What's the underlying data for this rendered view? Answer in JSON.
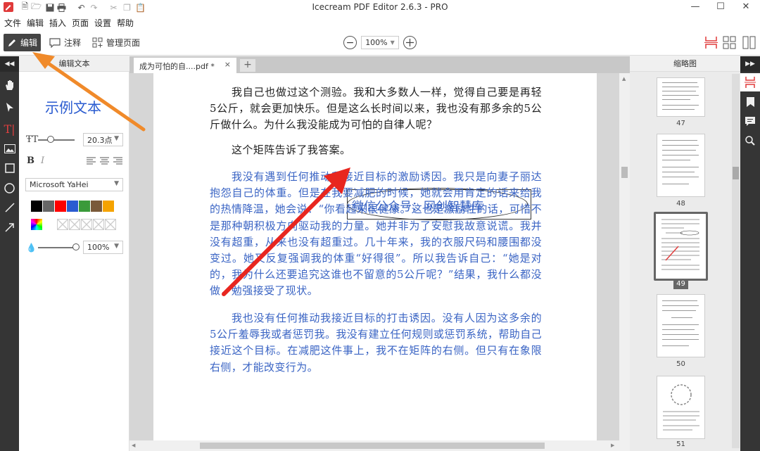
{
  "app": {
    "title": "Icecream PDF Editor 2.6.3 - PRO"
  },
  "menu": [
    "文件",
    "编辑",
    "插入",
    "页面",
    "设置",
    "帮助"
  ],
  "toolbar": {
    "edit_label": "编辑",
    "annotate_label": "注释",
    "manage_label": "管理页面",
    "zoom_value": "100%"
  },
  "edit_panel": {
    "header": "编辑文本",
    "sample_text": "示例文本",
    "font_size": "20.3点",
    "font_name": "Microsoft YaHei",
    "opacity": "100%",
    "colors": [
      "#000000",
      "#666666",
      "#ff0000",
      "#2a5bd0",
      "#3a9a3a",
      "#7a5a3a",
      "#f5a300"
    ]
  },
  "tab": {
    "title": "成为可怕的自....pdf *",
    "close": "×",
    "add": "+"
  },
  "document": {
    "para1": "我自己也做过这个测验。我和大多数人一样，觉得自己要是再轻5公斤，就会更加快乐。但是这么长时间以来，我也没有那多余的5公斤做什么。为什么我没能成为可怕的自律人呢？",
    "para2": "这个矩阵告诉了我答案。",
    "annotation": "微信公众号：网创智慧库",
    "para3": "我没有遇到任何推动我接近目标的激励诱因。我只是向妻子丽达抱怨自己的体重。但是在我要减肥的时候，她就会用肯定的话来给我的热情降温，她会说：“你看起来很健康。”这也是激励性的话，可惜不是那种朝积极方向驱动我的力量。她并非为了安慰我故意说谎。我并没有超重，从来也没有超重过。几十年来，我的衣服尺码和腰围都没变过。她又反复强调我的体重“好得很”。所以我告诉自己：“她是对的，我为什么还要追究这谁也不留意的5公斤呢？”结果，我什么都没做，勉强接受了现状。",
    "para4": "我也没有任何推动我接近目标的打击诱因。没有人因为这多余的5公斤羞辱我或者惩罚我。我没有建立任何规则或惩罚系统，帮助自己接近这个目标。在减肥这件事上，我不在矩阵的右侧。但只有在象限右侧，才能改变行为。"
  },
  "thumbnails": {
    "header": "缩略图",
    "pages": [
      "47",
      "48",
      "49",
      "50",
      "51"
    ],
    "active": "49"
  }
}
